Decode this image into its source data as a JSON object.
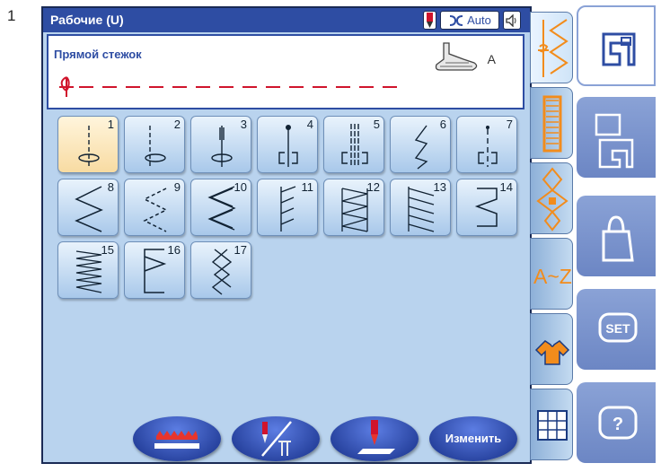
{
  "page_number": "1",
  "header": {
    "title": "Рабочие (U)",
    "auto_label": "Auto"
  },
  "info": {
    "stitch_name": "Прямой стежок",
    "foot_letter": "A"
  },
  "stitches": [
    {
      "num": "1",
      "icon": "straight-stitch-center-icon",
      "selected": true
    },
    {
      "num": "2",
      "icon": "straight-stitch-left-icon"
    },
    {
      "num": "3",
      "icon": "lock-stitch-icon"
    },
    {
      "num": "4",
      "icon": "straight-stitch-lock-icon"
    },
    {
      "num": "5",
      "icon": "triple-straight-stitch-icon"
    },
    {
      "num": "6",
      "icon": "stretch-stitch-icon"
    },
    {
      "num": "7",
      "icon": "basting-stitch-icon"
    },
    {
      "num": "8",
      "icon": "zigzag-stitch-icon"
    },
    {
      "num": "9",
      "icon": "multi-zigzag-stitch-icon"
    },
    {
      "num": "10",
      "icon": "triple-zigzag-stitch-icon"
    },
    {
      "num": "11",
      "icon": "blind-hem-stitch-icon"
    },
    {
      "num": "12",
      "icon": "overcast-stitch-icon"
    },
    {
      "num": "13",
      "icon": "overlock-stitch-icon"
    },
    {
      "num": "14",
      "icon": "blanket-stitch-icon"
    },
    {
      "num": "15",
      "icon": "knit-stitch-icon"
    },
    {
      "num": "16",
      "icon": "box-stitch-icon"
    },
    {
      "num": "17",
      "icon": "feather-stitch-icon"
    }
  ],
  "bottom_buttons": {
    "change_label": "Изменить"
  },
  "side_tabs": [
    "utility-stitch-icon",
    "buttonhole-icon",
    "decorative-stitch-icon",
    "alphabet-tab",
    "heirloom-icon",
    "grid-quilt-icon"
  ],
  "alphabet_tab_label": "A~Z",
  "right_buttons": {
    "set_label": "SET",
    "help_label": "?"
  },
  "colors": {
    "header": "#2e4da3",
    "screen_bg": "#b9d3ee",
    "accent": "#f28c1c",
    "stitch_red": "#d0142c"
  }
}
